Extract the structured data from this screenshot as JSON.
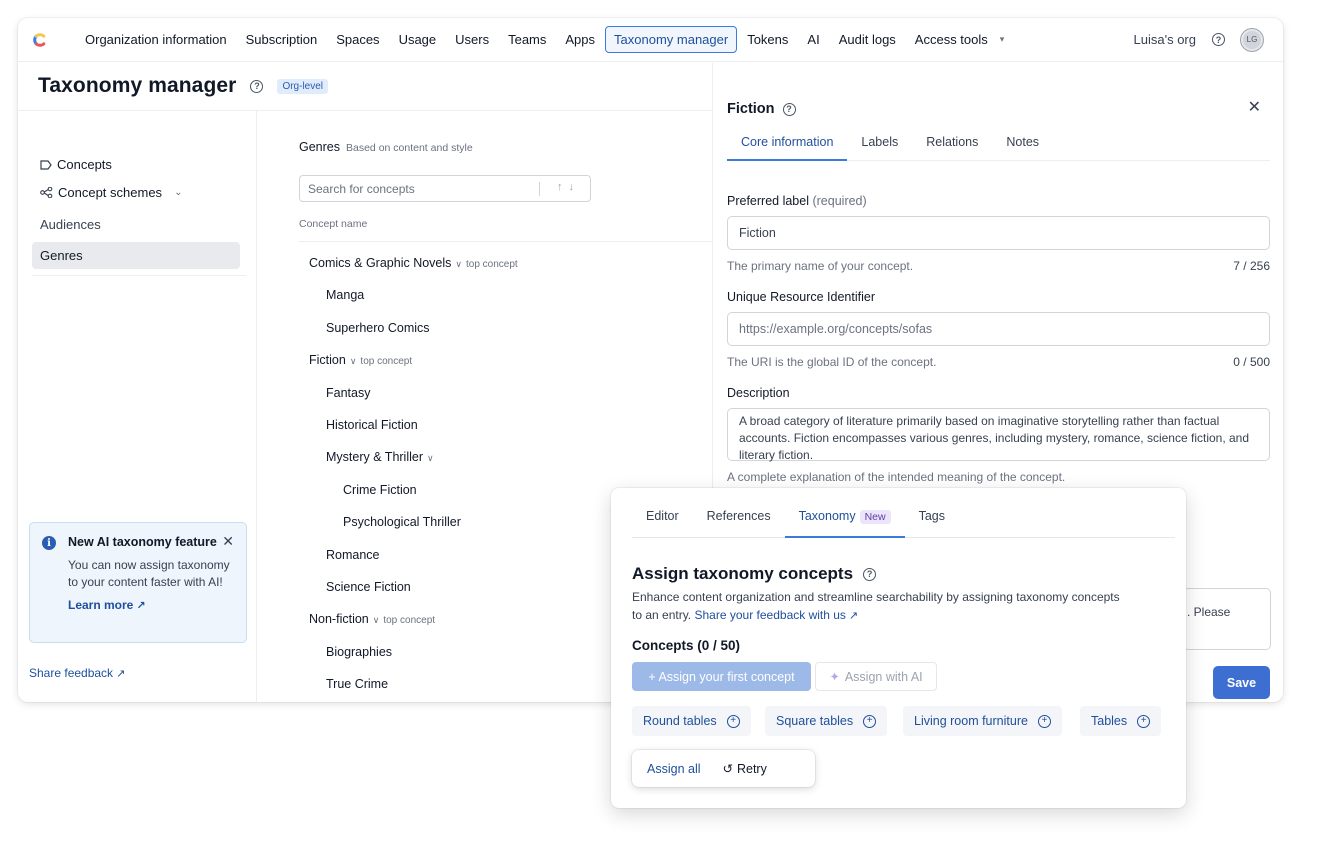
{
  "nav": {
    "items": [
      "Organization information",
      "Subscription",
      "Spaces",
      "Usage",
      "Users",
      "Teams",
      "Apps",
      "Taxonomy manager",
      "Tokens",
      "AI",
      "Audit logs",
      "Access tools"
    ],
    "active_index": 7,
    "org_name": "Luisa's org",
    "avatar_initials": "LG",
    "accent": "#3c7bd9"
  },
  "header": {
    "title": "Taxonomy manager",
    "badge": "Org-level"
  },
  "sidebar": {
    "concepts": "Concepts",
    "schemes": "Concept schemes",
    "audiences": "Audiences",
    "genres": "Genres",
    "ai_card": {
      "title": "New AI taxonomy feature",
      "body": "You can now assign taxonomy to your content faster with AI!",
      "link": "Learn more"
    },
    "share_feedback": "Share feedback"
  },
  "tree": {
    "heading": "Genres",
    "heading_sub": "Based on content and style",
    "search_placeholder": "Search for concepts",
    "column": "Concept name",
    "top_tag": "top concept",
    "rows": [
      {
        "label": "Comics & Graphic Novels",
        "level": 0,
        "top": true
      },
      {
        "label": "Manga",
        "level": 1
      },
      {
        "label": "Superhero Comics",
        "level": 1
      },
      {
        "label": "Fiction",
        "level": 0,
        "top": true
      },
      {
        "label": "Fantasy",
        "level": 1
      },
      {
        "label": "Historical Fiction",
        "level": 1
      },
      {
        "label": "Mystery & Thriller",
        "level": 1,
        "expandable": true
      },
      {
        "label": "Crime Fiction",
        "level": 2
      },
      {
        "label": "Psychological Thriller",
        "level": 2
      },
      {
        "label": "Romance",
        "level": 1
      },
      {
        "label": "Science Fiction",
        "level": 1
      },
      {
        "label": "Non-fiction",
        "level": 0,
        "top": true
      },
      {
        "label": "Biographies",
        "level": 1
      },
      {
        "label": "True Crime",
        "level": 1
      }
    ]
  },
  "panel": {
    "title": "Fiction",
    "tabs": [
      "Core information",
      "Labels",
      "Relations",
      "Notes"
    ],
    "preferred_label": "Preferred label",
    "required": "(required)",
    "preferred_value": "Fiction",
    "preferred_help": "The primary name of your concept.",
    "preferred_count": "7 / 256",
    "uri_label": "Unique Resource Identifier",
    "uri_placeholder": "https://example.org/concepts/sofas",
    "uri_help": "The URI is the global ID of the concept.",
    "uri_count": "0 / 500",
    "desc_label": "Description",
    "desc_value": "A broad category of literature primarily based on imaginative storytelling rather than factual accounts. Fiction encompasses various genres, including mystery, romance, science fiction, and literary fiction.",
    "desc_help": "A complete explanation of the intended meaning of the concept.",
    "partial_text": ". Please",
    "save": "Save"
  },
  "taxonomy_card": {
    "tabs": [
      "Editor",
      "References",
      "Taxonomy",
      "Tags"
    ],
    "new_badge": "New",
    "title": "Assign taxonomy concepts",
    "desc": "Enhance content organization and streamline searchability by assigning taxonomy concepts to an entry.",
    "feedback_link": "Share your feedback with us",
    "count": "Concepts (0 / 50)",
    "assign_first": "+ Assign your first concept",
    "assign_ai": "Assign with AI",
    "suggestions": [
      "Round tables",
      "Square tables",
      "Living room furniture",
      "Tables"
    ],
    "assign_all": "Assign all",
    "retry": "Retry"
  }
}
